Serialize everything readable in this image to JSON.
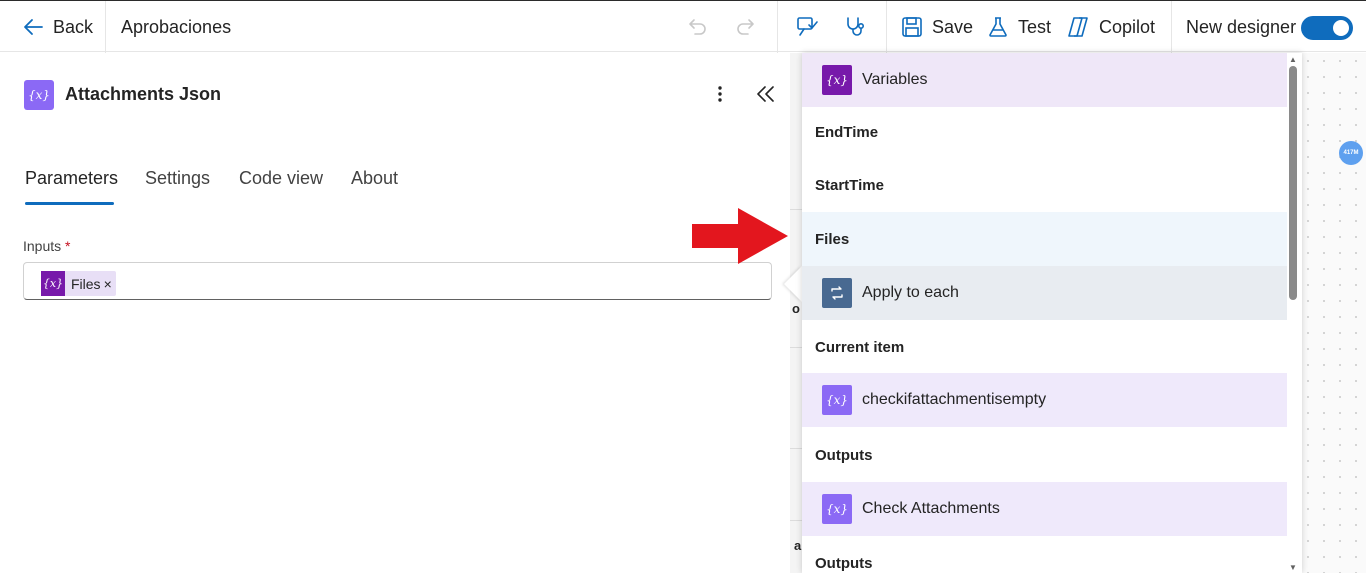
{
  "topbar": {
    "back_label": "Back",
    "flow_name": "Aprobaciones",
    "save_label": "Save",
    "test_label": "Test",
    "copilot_label": "Copilot",
    "new_designer_label": "New designer",
    "new_designer_on": true
  },
  "panel": {
    "title": "Attachments Json",
    "tabs": [
      "Parameters",
      "Settings",
      "Code view",
      "About"
    ],
    "active_tab": "Parameters",
    "inputs_label": "Inputs",
    "required_mark": "*",
    "token_label": "Files",
    "token_remove": "×"
  },
  "canvas": {
    "badge": "417M",
    "strip_chars": [
      "o",
      "a"
    ]
  },
  "dropdown": {
    "items": [
      {
        "kind": "header",
        "label": "Variables",
        "icon": "variable-icon",
        "bg": "#efe7f8",
        "icon_bg": "#7719aa"
      },
      {
        "kind": "item",
        "label": "EndTime"
      },
      {
        "kind": "item",
        "label": "StartTime"
      },
      {
        "kind": "item",
        "label": "Files",
        "highlight": "#eff6fc"
      },
      {
        "kind": "header",
        "label": "Apply to each",
        "icon": "loop-icon",
        "bg": "#e8ecf1",
        "icon_bg": "#486991"
      },
      {
        "kind": "item",
        "label": "Current item"
      },
      {
        "kind": "header",
        "label": "checkifattachmentisempty",
        "icon": "variable-icon",
        "bg": "#efe9fb",
        "icon_bg": "#8b69f5"
      },
      {
        "kind": "item",
        "label": "Outputs"
      },
      {
        "kind": "header",
        "label": "Check Attachments",
        "icon": "variable-icon",
        "bg": "#efe9fb",
        "icon_bg": "#8b69f5"
      },
      {
        "kind": "item",
        "label": "Outputs"
      }
    ]
  },
  "colors": {
    "accent": "#0f6cbd",
    "arrow": "#e3161e"
  }
}
